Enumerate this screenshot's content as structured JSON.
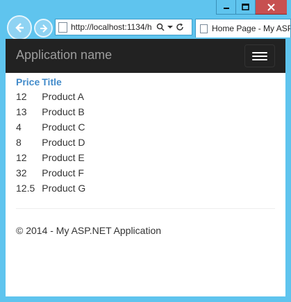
{
  "browser": {
    "url": "http://localhost:1134/h",
    "tab_title": "Home Page - My ASP.NET Application"
  },
  "navbar": {
    "brand": "Application name"
  },
  "table": {
    "headers": [
      "Price",
      "Title"
    ],
    "rows": [
      {
        "price": "12",
        "title": "Product A"
      },
      {
        "price": "13",
        "title": "Product B"
      },
      {
        "price": "4",
        "title": "Product C"
      },
      {
        "price": "8",
        "title": "Product D"
      },
      {
        "price": "12",
        "title": "Product E"
      },
      {
        "price": "32",
        "title": "Product F"
      },
      {
        "price": "12.5",
        "title": "Product G"
      }
    ]
  },
  "footer": {
    "text": "© 2014 - My ASP.NET Application"
  },
  "colors": {
    "frame": "#5fc4ee",
    "navbar": "#222222",
    "header_link": "#428bca",
    "close_button": "#c75050"
  }
}
